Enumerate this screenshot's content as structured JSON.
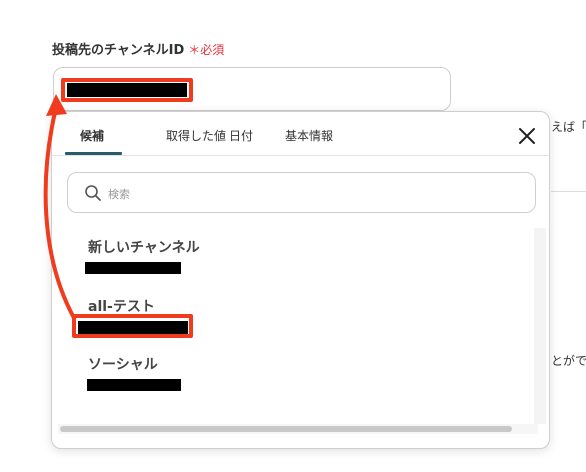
{
  "field": {
    "label": "投稿先のチャンネルID",
    "required_mark": "＊必須"
  },
  "side_texts": {
    "top": "えば「C",
    "bottom": "とがで"
  },
  "tabs": [
    {
      "label": "候補",
      "active": true
    },
    {
      "label": "取得した値",
      "active": false
    },
    {
      "label": "日付",
      "active": false
    },
    {
      "label": "基本情報",
      "active": false
    }
  ],
  "search": {
    "placeholder": "検索"
  },
  "options": [
    {
      "title": "新しいチャンネル"
    },
    {
      "title": "all-テスト"
    },
    {
      "title": "ソーシャル"
    }
  ],
  "colors": {
    "highlight": "#f03c1e",
    "tab_indicator": "#2b5b68",
    "required": "#e5323a"
  }
}
